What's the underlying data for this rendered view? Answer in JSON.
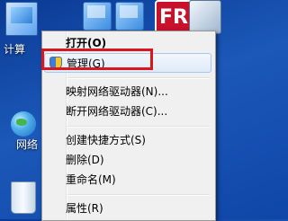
{
  "desktop": {
    "computer_label": "计算",
    "network_label": "网络",
    "red_app_glyph": "FR"
  },
  "context_menu": {
    "items": [
      {
        "label": "打开(O)",
        "bold": true
      },
      {
        "label": "管理(G)",
        "hovered": true,
        "icon": "uac-shield-icon"
      },
      {
        "label": "映射网络驱动器(N)..."
      },
      {
        "label": "断开网络驱动器(C)..."
      },
      {
        "label": "创建快捷方式(S)"
      },
      {
        "label": "删除(D)"
      },
      {
        "label": "重命名(M)"
      },
      {
        "label": "属性(R)"
      }
    ]
  },
  "colors": {
    "highlight_border": "#d8181f",
    "desktop_background": "#1c58b8",
    "menu_background": "#f0f0f0"
  }
}
